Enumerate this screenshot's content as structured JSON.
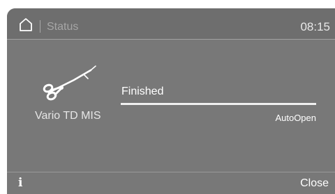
{
  "header": {
    "icon": "home-icon",
    "title": "Status",
    "time": "08:15"
  },
  "instrument": {
    "icon": "vario-td-mis-instrument-icon",
    "label": "Vario TD MIS"
  },
  "program": {
    "status": "Finished",
    "progress": 1.0,
    "option_label": "AutoOpen"
  },
  "footer": {
    "info_icon": "info-icon",
    "info_glyph": "i",
    "close_label": "Close"
  },
  "colors": {
    "screen_background": "#787878",
    "text_primary": "#ffffff",
    "text_dim": "#a6a6a6"
  }
}
